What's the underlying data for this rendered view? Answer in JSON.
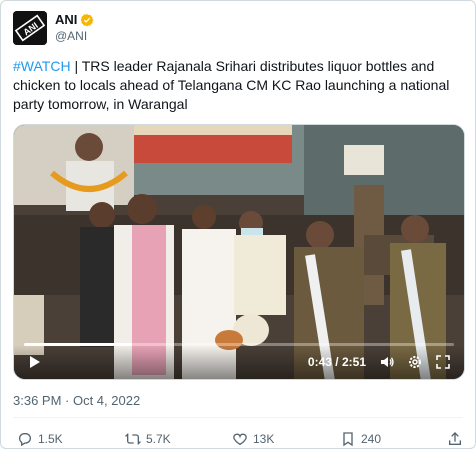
{
  "author": {
    "display_name": "ANI",
    "handle": "@ANI",
    "verified": true,
    "verified_color": "#f7b500",
    "avatar_icon": "ani-logo-icon"
  },
  "tweet": {
    "hashtag": "#WATCH",
    "text": " | TRS leader Rajanala Srihari distributes liquor bottles and chicken to locals ahead of Telangana CM KC Rao launching a national party tomorrow, in Warangal",
    "timestamp": "3:36 PM · Oct 4, 2022"
  },
  "video": {
    "current_time": "0:43",
    "separator": " / ",
    "duration": "2:51",
    "progress": 0.251,
    "icons": [
      "play-icon",
      "volume-icon",
      "settings-icon",
      "fullscreen-icon"
    ]
  },
  "actions": {
    "replies": "1.5K",
    "retweets": "5.7K",
    "likes": "13K",
    "bookmarks": "240"
  },
  "colors": {
    "link": "#1d9bf0",
    "secondary_text": "#536471",
    "border": "#cfd9de"
  }
}
